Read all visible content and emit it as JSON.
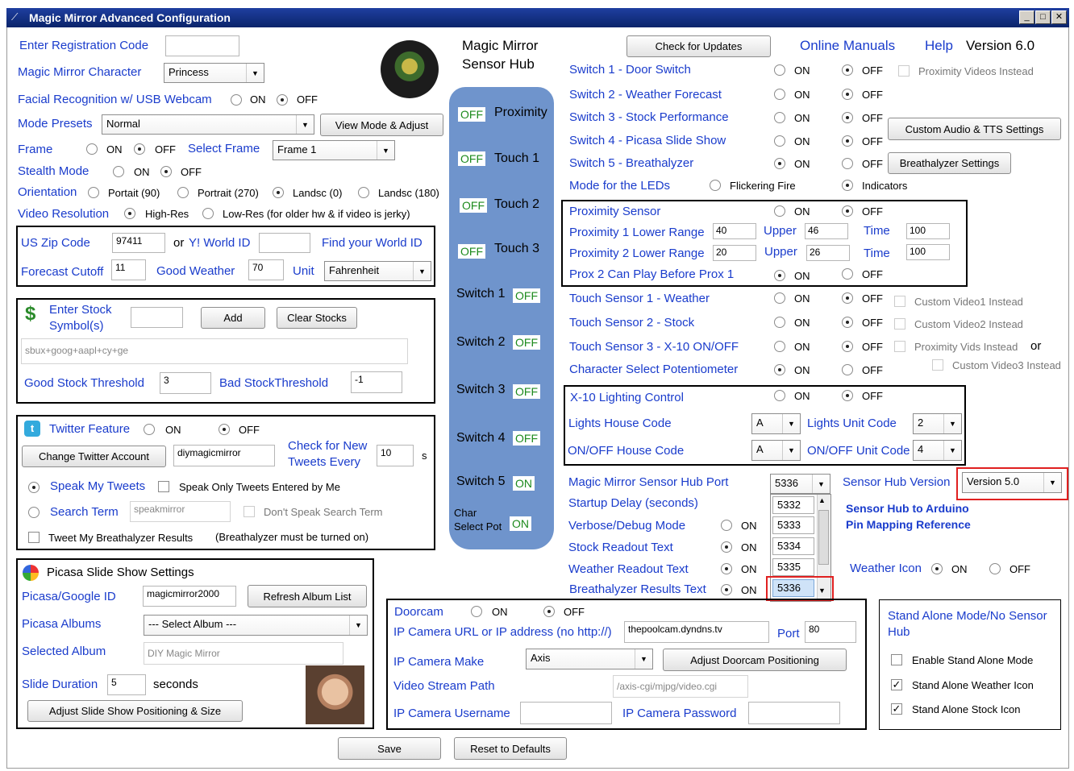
{
  "window": {
    "title": "Magic Mirror Advanced Configuration",
    "controls": [
      "_",
      "□",
      "✕"
    ]
  },
  "reg": {
    "label": "Enter Registration Code",
    "value": ""
  },
  "character": {
    "label": "Magic Mirror Character",
    "value": "Princess"
  },
  "face": {
    "label": "Facial Recognition w/ USB Webcam",
    "on": "ON",
    "off": "OFF"
  },
  "presets": {
    "label": "Mode Presets",
    "value": "Normal",
    "button": "View Mode & Adjust"
  },
  "frame": {
    "label": "Frame",
    "on": "ON",
    "off": "OFF",
    "select_label": "Select Frame",
    "value": "Frame 1"
  },
  "stealth": {
    "label": "Stealth Mode",
    "on": "ON",
    "off": "OFF"
  },
  "orientation": {
    "label": "Orientation",
    "o1": "Portait (90)",
    "o2": "Portrait (270)",
    "o3": "Landsc (0)",
    "o4": "Landsc (180)"
  },
  "video": {
    "label": "Video Resolution",
    "high": "High-Res",
    "low": "Low-Res (for older hw & if video is jerky)"
  },
  "weather": {
    "zip_label": "US Zip Code",
    "zip": "97411",
    "or": "or",
    "yid_label": "Y! World ID",
    "yid": "",
    "find": "Find your World ID",
    "cutoff_label": "Forecast Cutoff",
    "cutoff": "11",
    "good_label": "Good Weather",
    "good": "70",
    "unit_label": "Unit",
    "unit": "Fahrenheit"
  },
  "stock": {
    "label1": "Enter Stock",
    "label2": "Symbol(s)",
    "add": "Add",
    "clear": "Clear Stocks",
    "list": "sbux+goog+aapl+cy+ge",
    "good_label": "Good Stock Threshold",
    "good": "3",
    "bad_label": "Bad StockThreshold",
    "bad": "-1"
  },
  "twitter": {
    "label": "Twitter Feature",
    "on": "ON",
    "off": "OFF",
    "change": "Change Twitter Account",
    "account": "diymagicmirror",
    "check1": "Check for New",
    "check2": "Tweets Every",
    "interval": "10",
    "unit": "s",
    "speak": "Speak My Tweets",
    "speak_only": "Speak Only Tweets Entered by Me",
    "search_label": "Search Term",
    "search": "speakmirror",
    "dont_speak": "Don't Speak Search Term",
    "tweet_breath": "Tweet My Breathalyzer Results",
    "tweet_note": "(Breathalyzer must be turned on)"
  },
  "picasa": {
    "title": "Picasa Slide Show Settings",
    "id_label": "Picasa/Google ID",
    "id": "magicmirror2000",
    "refresh": "Refresh Album List",
    "albums_label": "Picasa Albums",
    "albums": "--- Select Album ---",
    "selected_label": "Selected Album",
    "selected": "DIY Magic Mirror",
    "duration_label": "Slide Duration",
    "duration": "5",
    "seconds": "seconds",
    "adjust": "Adjust Slide Show Positioning & Size"
  },
  "hub": {
    "title1": "Magic Mirror",
    "title2": "Sensor Hub",
    "proximity": {
      "state": "OFF",
      "label": "Proximity"
    },
    "touch1": {
      "state": "OFF",
      "label": "Touch 1"
    },
    "touch2": {
      "state": "OFF",
      "label": "Touch 2"
    },
    "touch3": {
      "state": "OFF",
      "label": "Touch 3"
    },
    "switch1": {
      "label": "Switch 1",
      "state": "OFF"
    },
    "switch2": {
      "label": "Switch 2",
      "state": "OFF"
    },
    "switch3": {
      "label": "Switch 3",
      "state": "OFF"
    },
    "switch4": {
      "label": "Switch 4",
      "state": "OFF"
    },
    "switch5": {
      "label": "Switch 5",
      "state": "ON"
    },
    "charpot1": "Char",
    "charpot2": "Select Pot",
    "charpot_state": "ON"
  },
  "header": {
    "check_updates": "Check for Updates",
    "manuals": "Online Manuals",
    "help": "Help",
    "version": "Version 6.0"
  },
  "switches": {
    "s1": "Switch 1 - Door Switch",
    "s2": "Switch 2 - Weather Forecast",
    "s3": "Switch 3 - Stock Performance",
    "s4": "Switch 4 - Picasa Slide Show",
    "s5": "Switch 5 - Breathalyzer",
    "on": "ON",
    "off": "OFF",
    "prox_videos": "Proximity Videos Instead",
    "custom_audio": "Custom Audio & TTS Settings",
    "breath_settings": "Breathalyzer Settings",
    "leds_label": "Mode for the LEDs",
    "flicker": "Flickering Fire",
    "indicators": "Indicators"
  },
  "proximity": {
    "label": "Proximity Sensor",
    "on": "ON",
    "off": "OFF",
    "p1_label": "Proximity 1 Lower Range",
    "p1_lower": "40",
    "upper": "Upper",
    "p1_upper": "46",
    "time": "Time",
    "p1_time": "100",
    "p2_label": "Proximity 2 Lower Range",
    "p2_lower": "20",
    "p2_upper": "26",
    "p2_time": "100",
    "before_label": "Prox 2 Can Play Before Prox 1",
    "on2": "ON",
    "off2": "OFF"
  },
  "touch": {
    "t1": "Touch Sensor 1 - Weather",
    "t2": "Touch Sensor 2 - Stock",
    "t3": "Touch Sensor 3 - X-10 ON/OFF",
    "pot": "Character Select Potentiometer",
    "on": "ON",
    "off": "OFF",
    "cv1": "Custom Video1 Instead",
    "cv2": "Custom Video2 Instead",
    "pvi": "Proximity Vids Instead",
    "or": "or",
    "cv3": "Custom Video3 Instead"
  },
  "x10": {
    "label": "X-10 Lighting Control",
    "on": "ON",
    "off": "OFF",
    "house_label": "Lights House Code",
    "house": "A",
    "unit_label": "Lights Unit Code",
    "unit": "2",
    "onoff_house_label": "ON/OFF House Code",
    "onoff_house": "A",
    "onoff_unit_label": "ON/OFF Unit Code",
    "onoff_unit": "4"
  },
  "port": {
    "label": "Magic Mirror Sensor Hub Port",
    "value": "5336",
    "options": [
      "5332",
      "5333",
      "5334",
      "5335",
      "5336"
    ],
    "hubver_label": "Sensor Hub Version",
    "hubver": "Version 5.0",
    "arduino1": "Sensor Hub to Arduino",
    "arduino2": "Pin Mapping Reference"
  },
  "misc": {
    "startup": "Startup Delay (seconds)",
    "verbose": "Verbose/Debug Mode",
    "stock_readout": "Stock Readout Text",
    "weather_readout": "Weather Readout Text",
    "breath_text": "Breathalyzer Results Text",
    "on": "ON",
    "weather_icon": "Weather Icon",
    "off": "OFF"
  },
  "doorcam": {
    "label": "Doorcam",
    "on": "ON",
    "off": "OFF",
    "url_label": "IP Camera URL or IP address (no http://)",
    "url": "thepoolcam.dyndns.tv",
    "port_label": "Port",
    "port": "80",
    "make_label": "IP Camera Make",
    "make": "Axis",
    "adjust": "Adjust Doorcam Positioning",
    "path_label": "Video Stream Path",
    "path": "/axis-cgi/mjpg/video.cgi",
    "user_label": "IP Camera Username",
    "user": "",
    "pass_label": "IP Camera Password",
    "pass": ""
  },
  "standalone": {
    "title1": "Stand Alone Mode/No Sensor",
    "title2": "Hub",
    "enable": "Enable Stand Alone Mode",
    "weather": "Stand Alone Weather Icon",
    "stock": "Stand Alone Stock Icon"
  },
  "footer": {
    "save": "Save",
    "reset": "Reset to Defaults"
  },
  "colors": {
    "link": "#1a3ccc",
    "hub": "#6f94cc",
    "state_green": "#1d8a1d",
    "highlight": "#e02020"
  }
}
